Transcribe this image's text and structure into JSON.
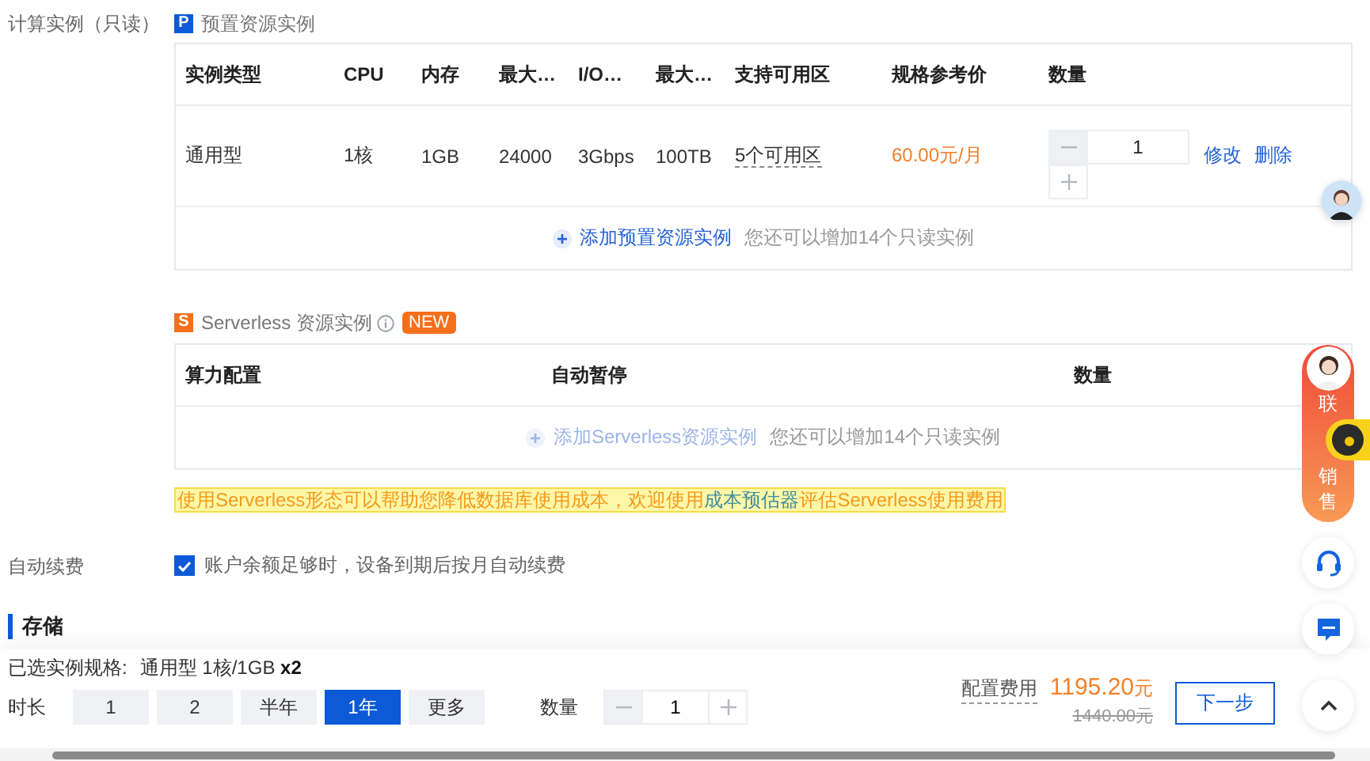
{
  "compute": {
    "label": "计算实例（只读）",
    "provisioned": {
      "badge": "P",
      "title": "预置资源实例",
      "columns": [
        "实例类型",
        "CPU",
        "内存",
        "最大…",
        "I/O…",
        "最大…",
        "支持可用区",
        "规格参考价",
        "数量"
      ],
      "rows": [
        {
          "cells": [
            "通用型",
            "1核",
            "1GB",
            "24000",
            "3Gbps",
            "100TB"
          ],
          "zones": "5个可用区",
          "price": "60.00元/月",
          "quantity": "1",
          "actions": [
            "修改",
            "删除"
          ]
        }
      ],
      "add_link": "添加预置资源实例",
      "add_disabled": false,
      "add_hint": "您还可以增加14个只读实例"
    },
    "serverless": {
      "badge": "S",
      "title": "Serverless 资源实例",
      "tag": "NEW",
      "columns": [
        "算力配置",
        "自动暂停",
        "数量"
      ],
      "add_link": "添加Serverless资源实例",
      "add_disabled": true,
      "add_hint": "您还可以增加14个只读实例"
    },
    "notice": {
      "before": "使用Serverless形态可以帮助您降低数据库使用成本，欢迎使用",
      "link": "成本预估器",
      "after": "评估Serverless使用费用"
    }
  },
  "auto_renew": {
    "label": "自动续费",
    "checked": true,
    "text": "账户余额足够时，设备到期后按月自动续费"
  },
  "storage_heading": "存储",
  "footer": {
    "spec_label": "已选实例规格:",
    "spec_value": "通用型 1核/1GB",
    "spec_count": "x2",
    "duration_label": "时长",
    "durations": [
      {
        "label": "1",
        "selected": false
      },
      {
        "label": "2",
        "selected": false
      },
      {
        "label": "半年",
        "selected": false
      },
      {
        "label": "1年",
        "selected": true
      },
      {
        "label": "更多",
        "selected": false
      }
    ],
    "quantity_label": "数量",
    "quantity": "1",
    "fee_label": "配置费用",
    "price": "1195.20",
    "price_unit": "元",
    "original_price": "1440.00元",
    "next": "下一步"
  },
  "sales_widget": {
    "chars": [
      "联",
      "销",
      "售"
    ]
  }
}
